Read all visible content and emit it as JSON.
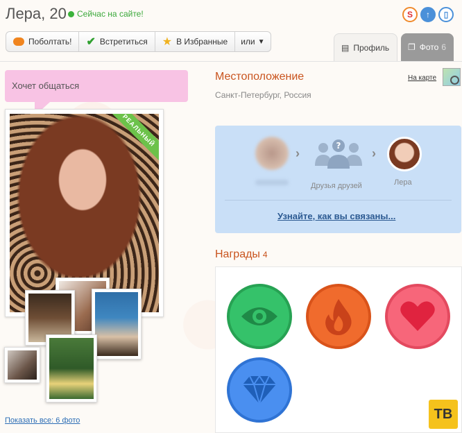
{
  "header": {
    "name": "Лера, 20",
    "online_status": "Сейчас на сайте!",
    "icons": [
      "s-logo-icon",
      "upload-arrow-icon",
      "phone-icon"
    ]
  },
  "actions": {
    "chat": "Поболтать!",
    "meet": "Встретиться",
    "favorites": "В Избранные",
    "more": "или"
  },
  "tabs": {
    "profile": "Профиль",
    "photos": "Фото",
    "photos_count": "6"
  },
  "left": {
    "status_bubble": "Хочет общаться",
    "real_badge": "РЕАЛЬНЫЙ",
    "show_all": "Показать все: 6 фото"
  },
  "location": {
    "title": "Местоположение",
    "value": "Санкт-Петербург, Россия",
    "map_link": "На карте"
  },
  "connection": {
    "middle_label": "Друзья друзей",
    "target_label": "Лера",
    "link": "Узнайте, как вы связаны..."
  },
  "awards": {
    "title": "Награды",
    "count": "4",
    "items": [
      "eye-icon",
      "fire-icon",
      "heart-icon",
      "diamond-icon"
    ]
  },
  "watermark": "ТВ",
  "colors": {
    "accent_orange": "#c9541e",
    "online_green": "#3aa83a",
    "speech_pink": "#f8c3e4",
    "connection_blue": "#c9dff7"
  }
}
